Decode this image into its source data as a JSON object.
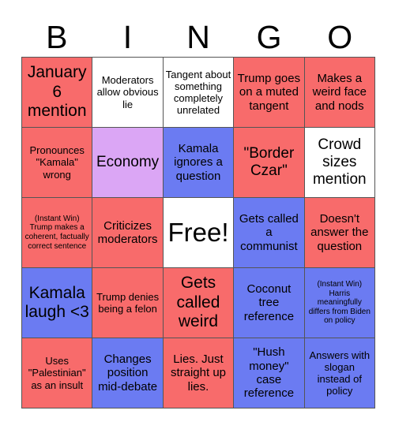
{
  "header": {
    "letters": [
      "B",
      "I",
      "N",
      "G",
      "O"
    ]
  },
  "colors": {
    "red": "#F86B6B",
    "blue": "#6B7BF2",
    "purple": "#DBA6F5",
    "white": "#FFFFFF",
    "border": "#555555",
    "text": "#000000"
  },
  "grid": {
    "rows": [
      [
        {
          "text": "January 6 mention",
          "color": "red",
          "size": "xl"
        },
        {
          "text": "Moderators allow obvious lie",
          "color": "white",
          "size": "sm"
        },
        {
          "text": "Tangent about something completely unrelated",
          "color": "white",
          "size": "sm"
        },
        {
          "text": "Trump goes on a muted tangent",
          "color": "red",
          "size": "md"
        },
        {
          "text": "Makes a weird face and nods",
          "color": "red",
          "size": "md"
        }
      ],
      [
        {
          "text": "Pronounces \"Kamala\" wrong",
          "color": "red",
          "size": "sm"
        },
        {
          "text": "Economy",
          "color": "purple",
          "size": "lg"
        },
        {
          "text": "Kamala ignores a question",
          "color": "blue",
          "size": "md"
        },
        {
          "text": "\"Border Czar\"",
          "color": "red",
          "size": "lg"
        },
        {
          "text": "Crowd sizes mention",
          "color": "white",
          "size": "lg"
        }
      ],
      [
        {
          "text": "(Instant Win) Trump makes a coherent, factually correct sentence",
          "color": "red",
          "size": "xs"
        },
        {
          "text": "Criticizes moderators",
          "color": "red",
          "size": "md"
        },
        {
          "text": "Free!",
          "color": "white",
          "size": "free"
        },
        {
          "text": "Gets called a communist",
          "color": "blue",
          "size": "md"
        },
        {
          "text": "Doesn't answer the question",
          "color": "red",
          "size": "md"
        }
      ],
      [
        {
          "text": "Kamala laugh <3",
          "color": "blue",
          "size": "xl"
        },
        {
          "text": "Trump denies being a felon",
          "color": "red",
          "size": "sm"
        },
        {
          "text": "Gets called weird",
          "color": "red",
          "size": "xl"
        },
        {
          "text": "Coconut tree reference",
          "color": "blue",
          "size": "md"
        },
        {
          "text": "(Instant Win) Harris meaningfully differs from Biden on policy",
          "color": "blue",
          "size": "xs"
        }
      ],
      [
        {
          "text": "Uses \"Palestinian\" as an insult",
          "color": "red",
          "size": "sm"
        },
        {
          "text": "Changes position mid-debate",
          "color": "blue",
          "size": "md"
        },
        {
          "text": "Lies. Just straight up lies.",
          "color": "red",
          "size": "md"
        },
        {
          "text": "\"Hush money\" case reference",
          "color": "blue",
          "size": "md"
        },
        {
          "text": "Answers with slogan instead of policy",
          "color": "blue",
          "size": "sm"
        }
      ]
    ]
  }
}
